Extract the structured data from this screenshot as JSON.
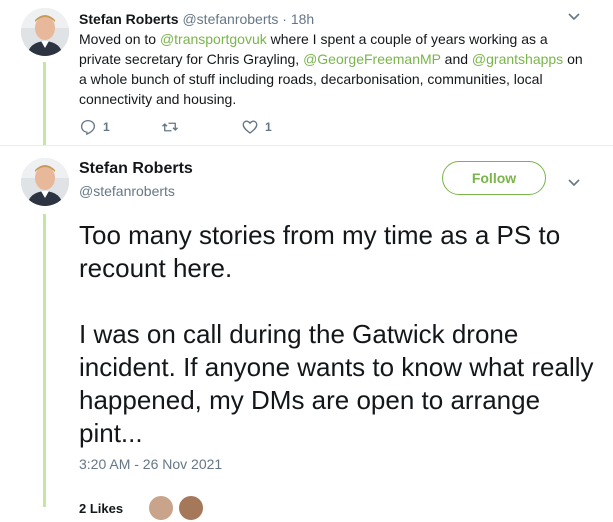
{
  "previous_tweet": {
    "author_name": "Stefan Roberts",
    "author_handle": "@stefanroberts",
    "separator": "·",
    "age": "18h",
    "text_1": "Moved on to ",
    "mention_1": "@transportgovuk",
    "text_2": " where I spent a couple of years working as a private secretary for Chris Grayling, ",
    "mention_2": "@GeorgeFreemanMP",
    "text_3": " and ",
    "mention_3": "@grantshapps",
    "text_4": " on a whole bunch of stuff including roads, decarbonisation, communities, local connectivity and housing.",
    "reply_count": "1",
    "like_count": "1"
  },
  "main_tweet": {
    "author_name": "Stefan Roberts",
    "author_handle": "@stefanroberts",
    "follow_label": "Follow",
    "paragraph_1": "Too many stories from my time as a PS to recount here.",
    "paragraph_2": "I was on call during the Gatwick drone incident. If anyone wants to know what really happened, my DMs are open to arrange pint...",
    "timestamp": "3:20 AM - 26 Nov 2021",
    "likes_label": "2 Likes"
  },
  "colors": {
    "accent": "#79b54a",
    "thread_line": "#c5e5a3",
    "muted": "#657786"
  },
  "icons": [
    "reply-icon",
    "retweet-icon",
    "like-icon",
    "chevron-down-icon"
  ]
}
